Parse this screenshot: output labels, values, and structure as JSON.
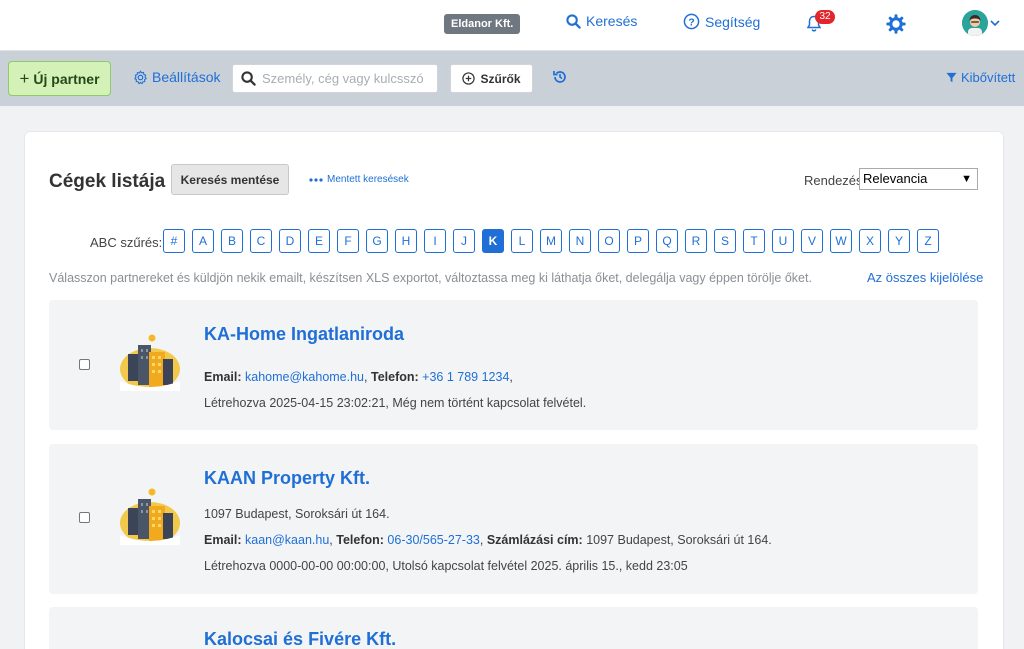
{
  "header": {
    "company": "Eldanor Kft.",
    "search_label": "Keresés",
    "help_label": "Segítség",
    "notification_count": "32"
  },
  "toolbar": {
    "new_partner_label": "Új partner",
    "settings_label": "Beállítások",
    "search_placeholder": "Személy, cég vagy kulcsszó",
    "filters_label": "Szűrők",
    "expanded_label": "Kibővített"
  },
  "main": {
    "title": "Cégek listája",
    "save_search_label": "Keresés mentése",
    "saved_searches_label": "Mentett keresések",
    "sort_label": "Rendezés",
    "sort_value": "Relevancia",
    "abc_label": "ABC szűrés:",
    "letters": [
      "#",
      "A",
      "B",
      "C",
      "D",
      "E",
      "F",
      "G",
      "H",
      "I",
      "J",
      "K",
      "L",
      "M",
      "N",
      "O",
      "P",
      "Q",
      "R",
      "S",
      "T",
      "U",
      "V",
      "W",
      "X",
      "Y",
      "Z"
    ],
    "active_letter": "K",
    "hint": "Válasszon partnereket és küldjön nekik emailt, készítsen XLS exportot, változtassa meg ki láthatja őket, delegálja vagy éppen törölje őket.",
    "select_all_label": "Az összes kijelölése"
  },
  "companies": [
    {
      "name": "KA-Home Ingatlaniroda",
      "email_label": "Email:",
      "email": "kahome@kahome.hu",
      "phone_label": "Telefon:",
      "phone": "+36 1 789 1234",
      "phone_suffix": ",",
      "created": "Létrehozva 2025-04-15 23:02:21, Még nem történt kapcsolat felvétel."
    },
    {
      "name": "KAAN Property Kft.",
      "address": "1097 Budapest, Soroksári út 164.",
      "email_label": "Email:",
      "email": "kaan@kaan.hu",
      "phone_label": "Telefon:",
      "phone": "06-30/565-27-33",
      "billing_label": "Számlázási cím:",
      "billing": "1097 Budapest, Soroksári út 164.",
      "created": "Létrehozva 0000-00-00 00:00:00, Utolsó kapcsolat felvétel 2025. április 15., kedd 23:05"
    },
    {
      "name": "Kalocsai és Fivére Kft."
    }
  ],
  "colors": {
    "accent": "#1f6fd6",
    "toolbar_bg": "#c9d0d8",
    "new_partner_bg": "#d4f2b8",
    "badge_red": "#e3262c"
  }
}
